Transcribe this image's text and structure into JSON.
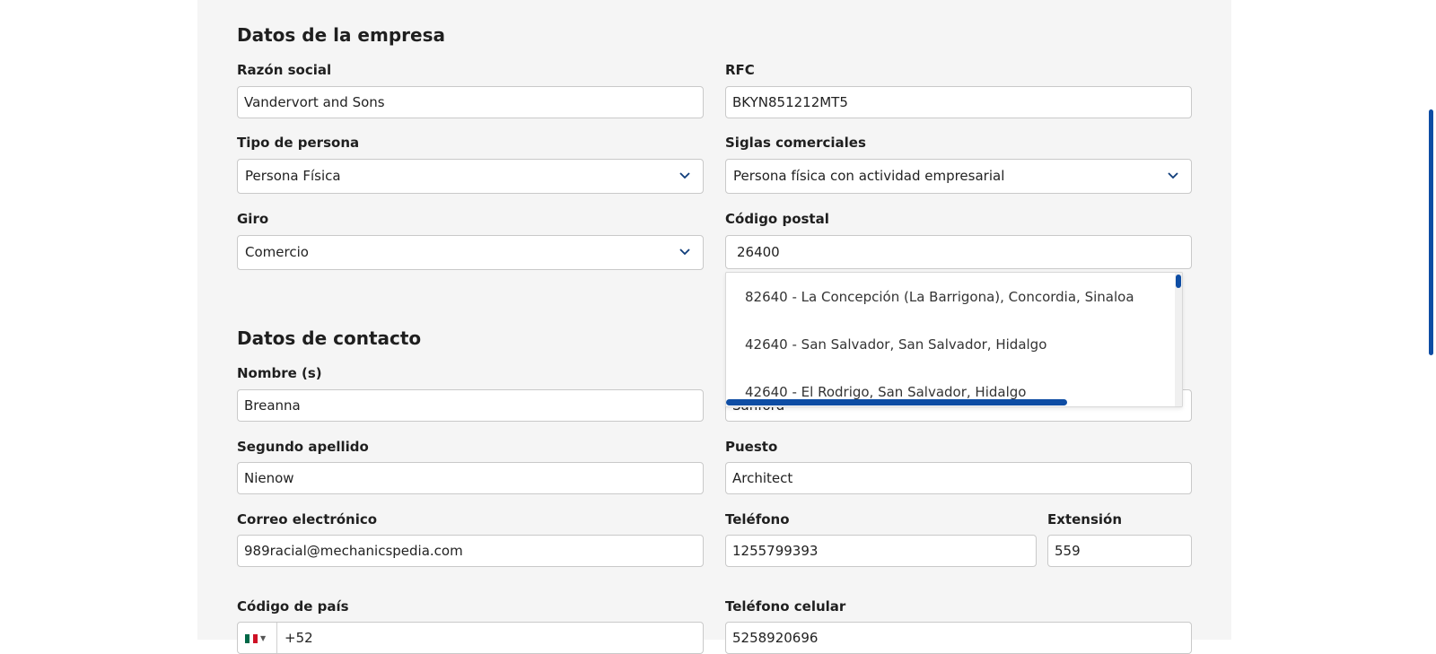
{
  "company_section": {
    "title": "Datos de la empresa",
    "razon_social": {
      "label": "Razón social",
      "value": "Vandervort and Sons"
    },
    "rfc": {
      "label": "RFC",
      "value": "BKYN851212MT5"
    },
    "tipo_persona": {
      "label": "Tipo de persona",
      "value": "Persona Física"
    },
    "siglas": {
      "label": "Siglas comerciales",
      "value": "Persona física con actividad empresarial"
    },
    "giro": {
      "label": "Giro",
      "value": "Comercio"
    },
    "codigo_postal": {
      "label": "Código postal",
      "value": "26400"
    }
  },
  "postal_suggestions": {
    "options": [
      "82640 - La Concepción (La Barrigona), Concordia, Sinaloa",
      "42640 - San Salvador, San Salvador, Hidalgo",
      "42640 - El Rodrigo, San Salvador, Hidalgo"
    ]
  },
  "contact_section": {
    "title": "Datos de contacto",
    "nombre": {
      "label": "Nombre (s)",
      "value": "Breanna"
    },
    "primer_apellido": {
      "value": "Sanford"
    },
    "segundo_apellido": {
      "label": "Segundo apellido",
      "value": "Nienow"
    },
    "puesto": {
      "label": "Puesto",
      "value": "Architect"
    },
    "correo": {
      "label": "Correo electrónico",
      "value": "989racial@mechanicspedia.com"
    },
    "telefono": {
      "label": "Teléfono",
      "value": "1255799393"
    },
    "extension": {
      "label": "Extensión",
      "value": "559"
    },
    "codigo_pais": {
      "label": "Código de país",
      "value": "+52",
      "flag_icon": "mexico-flag-icon"
    },
    "celular": {
      "label": "Teléfono celular",
      "value": "5258920696"
    }
  },
  "colors": {
    "accent": "#0e4da4",
    "panel_bg": "#f5f5f5",
    "input_border": "#c9c9c9"
  }
}
